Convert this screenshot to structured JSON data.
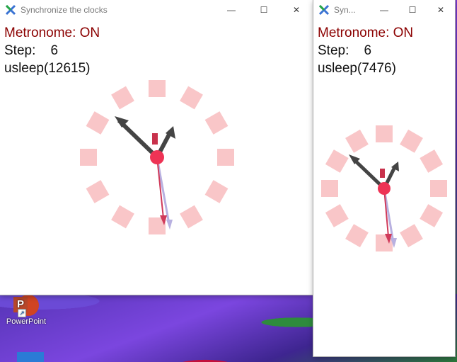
{
  "desktop": {
    "icons": [
      {
        "label": "PowerPoint",
        "icon": "powerpoint-icon",
        "glyph": "P"
      }
    ]
  },
  "windows": [
    {
      "title": "Synchronize the clocks",
      "metronome": "Metronome: ON",
      "step_label": "Step:",
      "step_value": "6",
      "usleep": "usleep(12615)"
    },
    {
      "title": "Syn...",
      "metronome": "Metronome: ON",
      "step_label": "Step:",
      "step_value": "6",
      "usleep": "usleep(7476)"
    }
  ],
  "controls": {
    "minimize": "—",
    "maximize": "☐",
    "close": "✕"
  },
  "colors": {
    "metronome_text": "#8b0000",
    "clock_marker": "#f9c6c8",
    "hand_dark": "#444444",
    "hand_red": "#e03a58",
    "hand_lavender": "#b8b0e0",
    "center_dot": "#ee3355",
    "app_icon_x": "#3a73d4"
  }
}
